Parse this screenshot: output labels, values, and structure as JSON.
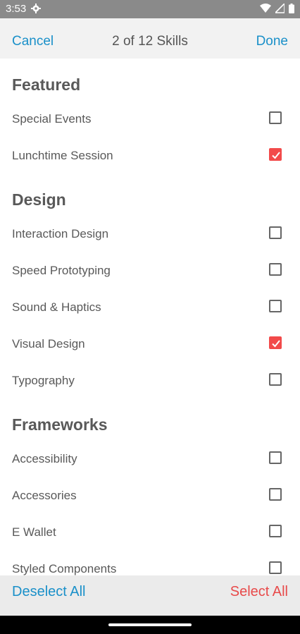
{
  "status": {
    "time": "3:53"
  },
  "nav": {
    "cancel_label": "Cancel",
    "title": "2 of 12 Skills",
    "done_label": "Done"
  },
  "sections": [
    {
      "title": "Featured",
      "items": [
        {
          "label": "Special Events",
          "checked": false
        },
        {
          "label": "Lunchtime Session",
          "checked": true
        }
      ]
    },
    {
      "title": "Design",
      "items": [
        {
          "label": "Interaction Design",
          "checked": false
        },
        {
          "label": "Speed Prototyping",
          "checked": false
        },
        {
          "label": "Sound & Haptics",
          "checked": false
        },
        {
          "label": "Visual Design",
          "checked": true
        },
        {
          "label": "Typography",
          "checked": false
        }
      ]
    },
    {
      "title": "Frameworks",
      "items": [
        {
          "label": "Accessibility",
          "checked": false
        },
        {
          "label": "Accessories",
          "checked": false
        },
        {
          "label": "E Wallet",
          "checked": false
        },
        {
          "label": "Styled Components",
          "checked": false
        }
      ]
    }
  ],
  "footer": {
    "deselect_label": "Deselect All",
    "select_label": "Select All"
  },
  "colors": {
    "accent_blue": "#1a90c9",
    "accent_red": "#e84a4a",
    "checkbox_checked": "#f24a4a"
  }
}
